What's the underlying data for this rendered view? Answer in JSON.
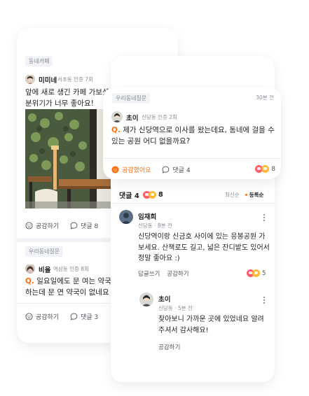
{
  "back_card": {
    "post1": {
      "tag": "동네카페",
      "author": "미미네",
      "meta": "서초동 인증 7회",
      "text_line1": "앞에 새로 생긴 카페 가보셨",
      "text_line2": "분위기가 너무 좋아요!",
      "like_label": "공감하기",
      "comment_label": "댓글 8"
    },
    "post2": {
      "tag": "우리동네질문",
      "author": "비올",
      "meta": "역삼동 인증 8회",
      "q_prefix": "Q.",
      "text_line1": "일요일에도 문 여는 약국 있나",
      "text_line2": "하는데 문 연 약국이 없네요 ㅠㅠ",
      "like_label": "공감하기",
      "comment_label": "댓글 3"
    }
  },
  "front_card": {
    "question": {
      "tag": "우리동네질문",
      "time": "30분 전",
      "author": "초이",
      "meta": "신당동 인증 2회",
      "q_prefix": "Q.",
      "text_line1": "제가 신당역으로 이사를 왔는데요, 동네에 걸을 수",
      "text_line2": "있는 공원 어디 없을까요?",
      "liked_label": "공감했어요",
      "comment_label": "댓글 4",
      "reaction_count": "8"
    },
    "comments_header": {
      "title": "댓글 4",
      "reaction_count": "8",
      "sort_latest": "최신순",
      "sort_registered": "등록순"
    },
    "comments": [
      {
        "author": "임재희",
        "meta": "신당동 · 8분 전",
        "line1": "신당역이랑 신금호 사이에 있는 응봉공원 가",
        "line2": "보세요. 산책로도 길고, 넓은 잔디밭도 있어서",
        "line3": "정말 좋아요 :)",
        "reply_label": "답글쓰기",
        "like_label": "공감하기",
        "reaction_count": "5"
      }
    ],
    "reply": {
      "author": "초이",
      "meta": "신당동 · 5분 전",
      "line1": "찾아보니 가까운 곳에 있었네요 알려",
      "line2": "주셔서 감사해요!",
      "like_label": "공감하기"
    }
  },
  "colors": {
    "accent": "#ff6f0f",
    "text": "#212124",
    "muted": "#868b94",
    "heart": "#ff5d6a",
    "emoji": "#ffb938"
  }
}
